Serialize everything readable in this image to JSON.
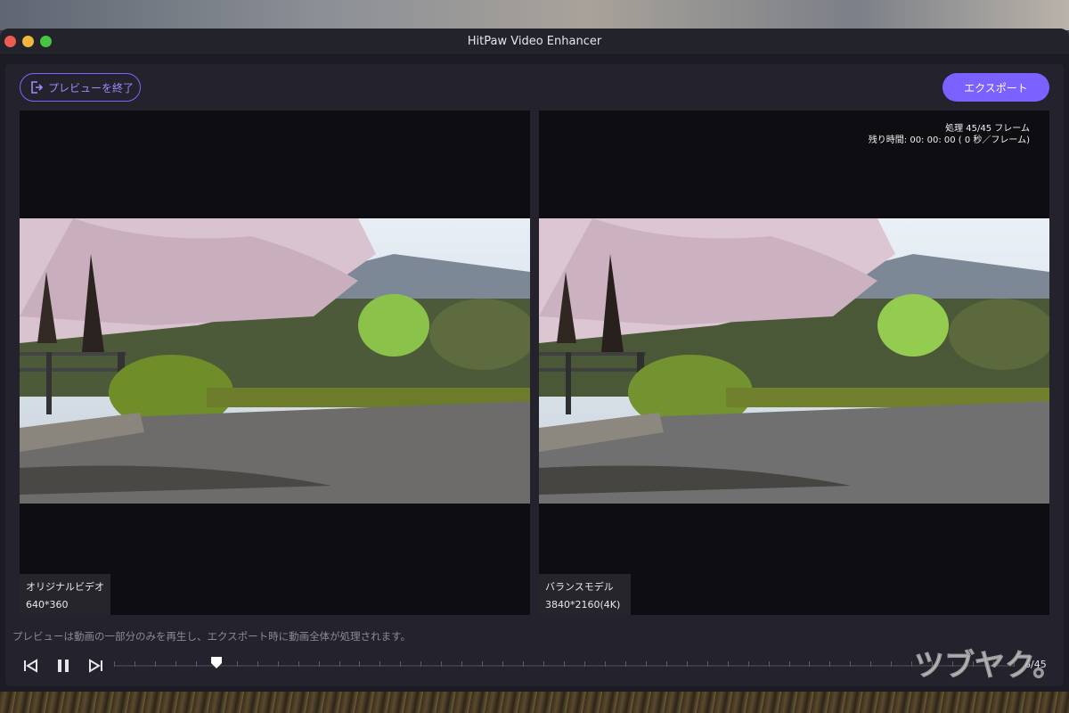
{
  "window": {
    "title": "HitPaw Video Enhancer"
  },
  "toolbar": {
    "exit_preview_label": "プレビューを終了",
    "export_label": "エクスポート"
  },
  "left_pane": {
    "name": "オリジナルビデオ",
    "resolution": "640*360"
  },
  "right_pane": {
    "name": "バランスモデル",
    "resolution": "3840*2160(4K)",
    "processing": "処理 45/45 フレーム",
    "remaining": "残り時間: 00: 00: 00 ( 0 秒／フレーム)"
  },
  "footer": {
    "note": "プレビューは動画の一部分のみを再生し、エクスポート時に動画全体が処理されます。",
    "frame_counter": "6/45"
  },
  "playback": {
    "current_frame": 6,
    "total_frames": 45
  },
  "watermark": {
    "text": "ツブヤク。"
  },
  "colors": {
    "accent": "#7b61ff",
    "window_bg": "#1c1c24",
    "panel_bg": "#23222d"
  },
  "icons": {
    "exit": "exit-icon",
    "prev": "step-back-icon",
    "pause": "pause-icon",
    "next": "step-forward-icon",
    "handle": "playhead-icon"
  }
}
